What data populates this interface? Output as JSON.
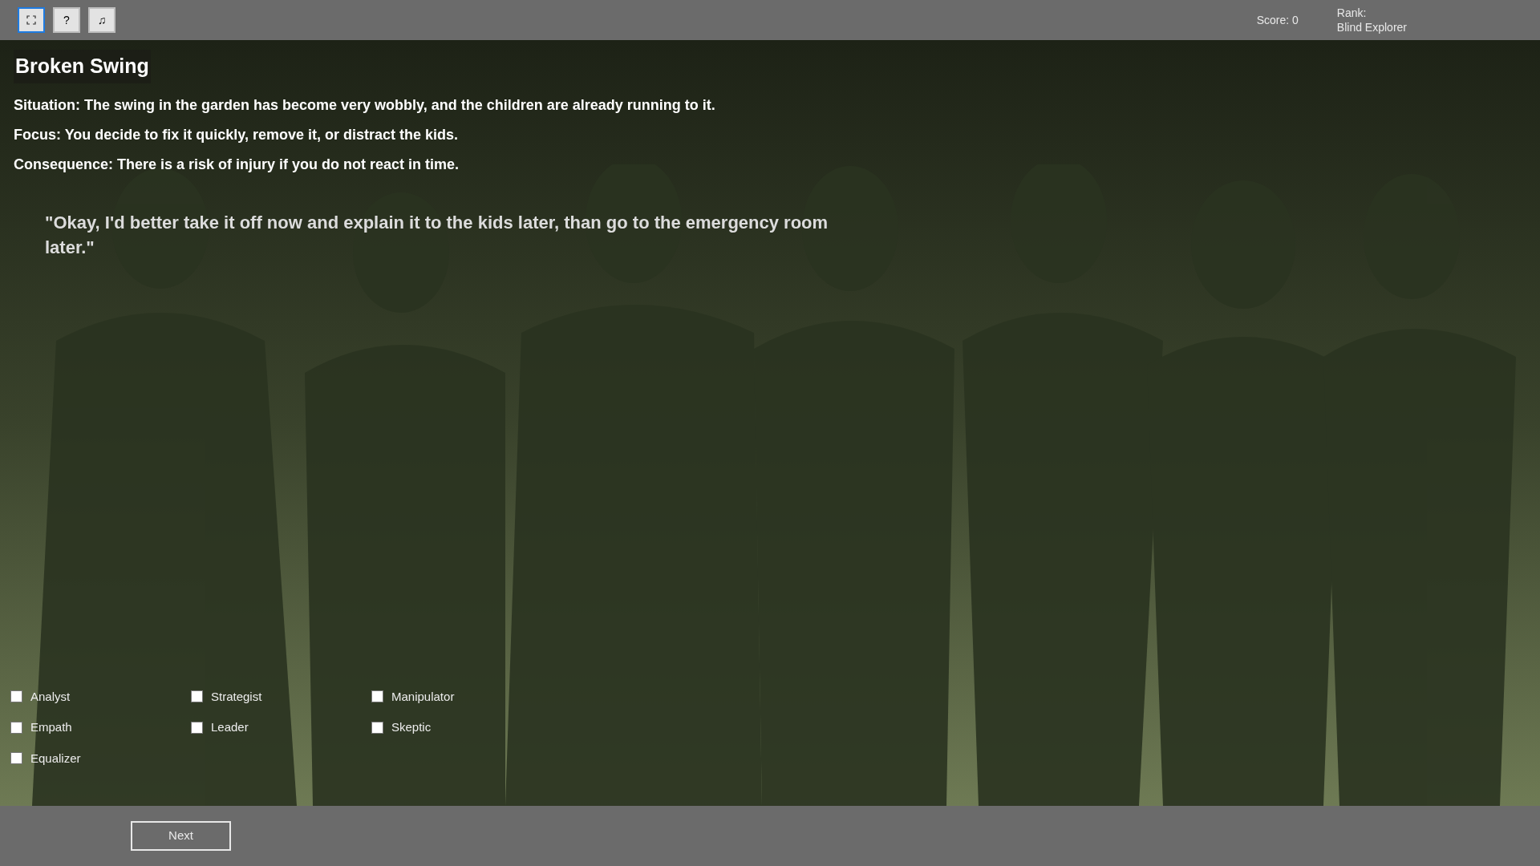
{
  "toolbar": {
    "buttons": [
      {
        "kind": "fullscreen",
        "focused": true
      },
      {
        "kind": "text",
        "label": "?",
        "focused": false
      },
      {
        "kind": "text",
        "label": "♫",
        "focused": false
      }
    ],
    "score": "Score: 0",
    "rank_label": "Rank:",
    "rank_value": "Blind Explorer"
  },
  "scenario": {
    "title": "Broken Swing",
    "lines": [
      "Situation: The swing in the garden has become very wobbly, and the children are already running to it.",
      "Focus: You decide to fix it quickly, remove it, or distract the kids.",
      "Consequence: There is a risk of injury if you do not react in time."
    ],
    "quote": "\"Okay, I'd better take it off now and explain it to the kids later, than go to the emergency room later.\""
  },
  "traits": [
    {
      "label": "Analyst",
      "checked": false
    },
    {
      "label": "Strategist",
      "checked": false
    },
    {
      "label": "Manipulator",
      "checked": false
    },
    {
      "label": "Empath",
      "checked": false
    },
    {
      "label": "Leader",
      "checked": false
    },
    {
      "label": "Skeptic",
      "checked": false
    },
    {
      "label": "Equalizer",
      "checked": false
    }
  ],
  "next_button": "Next"
}
